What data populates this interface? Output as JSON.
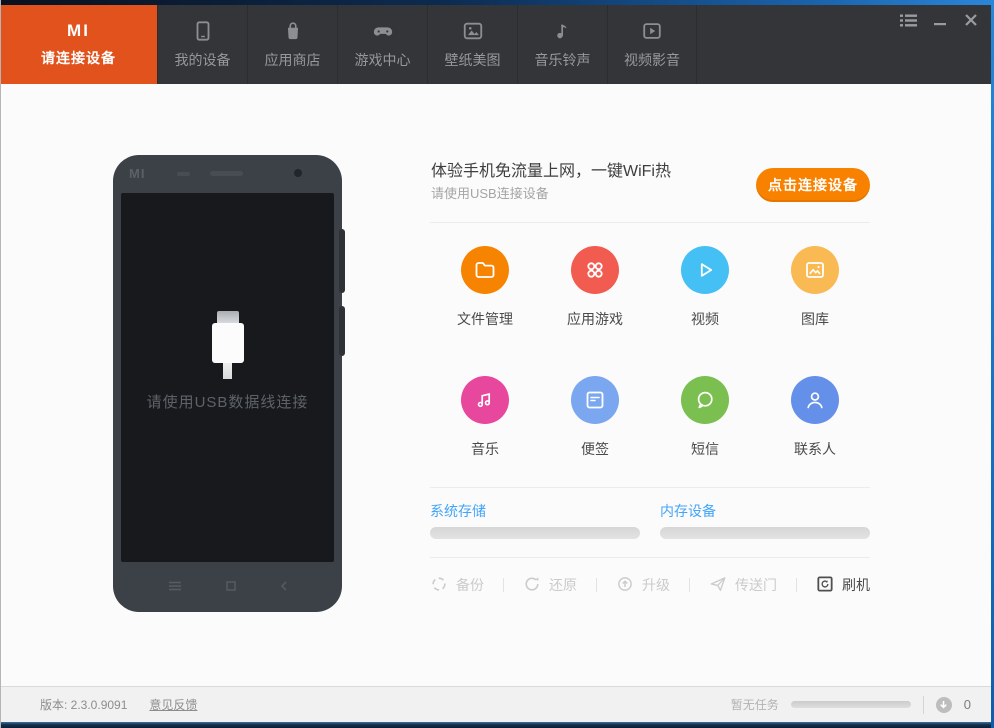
{
  "colors": {
    "active_tab_orange": "#e2521c",
    "connect_button_orange": "#f88100",
    "storage_label_blue": "#43a5f7"
  },
  "navbar": {
    "active_tab": {
      "logo": "MI",
      "label": "请连接设备"
    },
    "tabs": [
      {
        "label": "我的设备",
        "icon": "device-icon"
      },
      {
        "label": "应用商店",
        "icon": "store-bag-icon"
      },
      {
        "label": "游戏中心",
        "icon": "gamepad-icon"
      },
      {
        "label": "壁纸美图",
        "icon": "wallpaper-icon"
      },
      {
        "label": "音乐铃声",
        "icon": "music-note-icon"
      },
      {
        "label": "视频影音",
        "icon": "video-icon"
      }
    ]
  },
  "phone": {
    "brand": "MI",
    "screen_message": "请使用USB数据线连接"
  },
  "connect": {
    "headline": "体验手机免流量上网，一键WiFi热",
    "subline": "请使用USB连接设备",
    "button_label": "点击连接设备"
  },
  "shortcuts": [
    {
      "label": "文件管理",
      "icon": "folder-icon",
      "color": "#f78400"
    },
    {
      "label": "应用游戏",
      "icon": "apps-icon",
      "color": "#f25b50"
    },
    {
      "label": "视频",
      "icon": "play-icon",
      "color": "#45c0f5"
    },
    {
      "label": "图库",
      "icon": "gallery-icon",
      "color": "#f9b953"
    },
    {
      "label": "音乐",
      "icon": "music-notes-icon",
      "color": "#e8479e"
    },
    {
      "label": "便签",
      "icon": "note-icon",
      "color": "#7ba7f0"
    },
    {
      "label": "短信",
      "icon": "sms-icon",
      "color": "#7abf4f"
    },
    {
      "label": "联系人",
      "icon": "contacts-icon",
      "color": "#6590e9"
    }
  ],
  "storage": {
    "system": {
      "label": "系统存储",
      "progress_percent": 0
    },
    "memory": {
      "label": "内存设备",
      "progress_percent": 0
    }
  },
  "toolbar": {
    "backup": {
      "label": "备份"
    },
    "restore": {
      "label": "还原"
    },
    "upgrade": {
      "label": "升级"
    },
    "portal": {
      "label": "传送门"
    },
    "flash": {
      "label": "刷机"
    }
  },
  "footer": {
    "version": "版本: 2.3.0.9091",
    "feedback": "意见反馈",
    "task_status": "暂无任务",
    "task_progress_percent": 0,
    "task_count": "0"
  }
}
